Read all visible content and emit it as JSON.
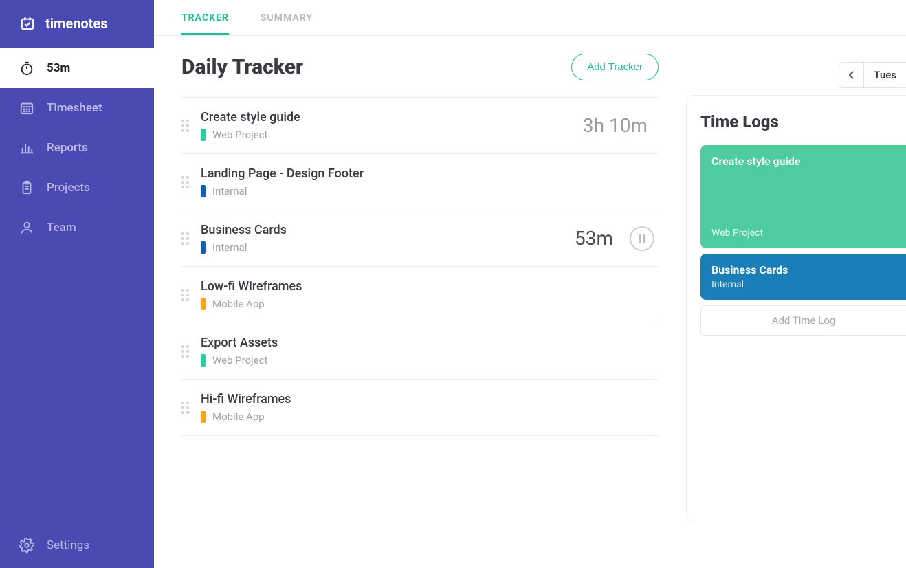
{
  "brand": "timenotes",
  "sidebar": {
    "active_timer": "53m",
    "items": [
      {
        "label": "Timesheet"
      },
      {
        "label": "Reports"
      },
      {
        "label": "Projects"
      },
      {
        "label": "Team"
      }
    ],
    "settings_label": "Settings"
  },
  "tabs": {
    "tracker": "TRACKER",
    "summary": "SUMMARY"
  },
  "page_title": "Daily Tracker",
  "add_tracker_label": "Add Tracker",
  "date_label": "Tues",
  "projects": {
    "web": {
      "name": "Web Project",
      "color": "#33c8a1"
    },
    "internal": {
      "name": "Internal",
      "color": "#165fb0"
    },
    "mobile": {
      "name": "Mobile App",
      "color": "#f5a623"
    }
  },
  "trackers": [
    {
      "title": "Create style guide",
      "project": "web",
      "time": "3h 10m",
      "running": false
    },
    {
      "title": "Landing Page - Design Footer",
      "project": "internal",
      "time": "",
      "running": false
    },
    {
      "title": "Business Cards",
      "project": "internal",
      "time": "53m",
      "running": true
    },
    {
      "title": "Low-fi Wireframes",
      "project": "mobile",
      "time": "",
      "running": false
    },
    {
      "title": "Export Assets",
      "project": "web",
      "time": "",
      "running": false
    },
    {
      "title": "Hi-fi Wireframes",
      "project": "mobile",
      "time": "",
      "running": false
    }
  ],
  "time_logs": {
    "heading": "Time Logs",
    "cards": [
      {
        "title": "Create style guide",
        "sub": "Web Project",
        "color": "#4ecb9f",
        "kind": "primary"
      },
      {
        "title": "Business Cards",
        "sub": "Internal",
        "color": "#1a7eb8",
        "kind": "secondary"
      }
    ],
    "add_label": "Add Time Log"
  }
}
